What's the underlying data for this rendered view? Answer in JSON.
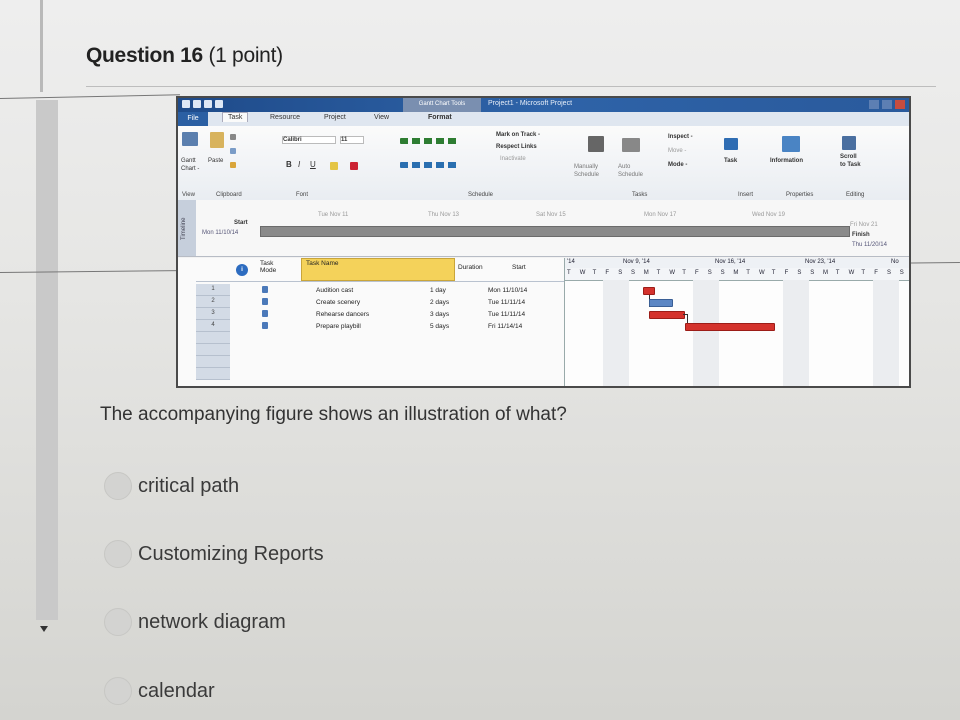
{
  "question": {
    "number_label": "Question 16",
    "points_label": "(1 point)",
    "prompt": "The accompanying figure shows an illustration of what?",
    "options": [
      {
        "label": "critical path"
      },
      {
        "label": "Customizing Reports"
      },
      {
        "label": "network diagram"
      },
      {
        "label": "calendar"
      }
    ]
  },
  "project_window": {
    "context_tab": "Gantt Chart Tools",
    "title": "Project1 - Microsoft Project",
    "tabs": [
      "File",
      "Task",
      "Resource",
      "Project",
      "View",
      "Format"
    ],
    "ribbon": {
      "view_group": [
        "Gantt",
        "Chart -",
        "View"
      ],
      "clipboard": {
        "paste": "Paste",
        "label": "Clipboard"
      },
      "font": {
        "name": "Calibri",
        "size": "11",
        "label": "Font"
      },
      "schedule": {
        "mark": "Mark on Track -",
        "respect": "Respect Links",
        "inactivate": "Inactivate",
        "label": "Schedule"
      },
      "tasks": {
        "manually": "Manually",
        "schedule_word": "Schedule",
        "auto": "Auto",
        "schedule_word2": "Schedule",
        "inspect": "Inspect -",
        "move": "Move -",
        "mode": "Mode -",
        "label": "Tasks"
      },
      "insert": {
        "task": "Task",
        "label": "Insert"
      },
      "properties": {
        "information": "Information",
        "label": "Properties"
      },
      "editing": {
        "scroll": "Scroll",
        "to_task": "to Task",
        "label": "Editing"
      }
    },
    "timeline": {
      "side_label": "Timeline",
      "dates": [
        "Tue Nov 11",
        "Thu Nov 13",
        "Sat Nov 15",
        "Mon Nov 17",
        "Wed Nov 19",
        "Fri Nov 21"
      ],
      "start_label": "Start",
      "start_date": "Mon 11/10/14",
      "finish_label": "Finish",
      "finish_date": "Thu 11/20/14"
    },
    "table": {
      "headers": {
        "info": "i",
        "mode": "Task Mode",
        "name": "Task Name",
        "duration": "Duration",
        "start": "Start"
      },
      "rows": [
        {
          "id": "1",
          "name": "Audition cast",
          "duration": "1 day",
          "start": "Mon 11/10/14"
        },
        {
          "id": "2",
          "name": "Create scenery",
          "duration": "2 days",
          "start": "Tue 11/11/14"
        },
        {
          "id": "3",
          "name": "Rehearse dancers",
          "duration": "3 days",
          "start": "Tue 11/11/14"
        },
        {
          "id": "4",
          "name": "Prepare playbill",
          "duration": "5 days",
          "start": "Fri 11/14/14"
        }
      ]
    },
    "gantt": {
      "week_labels": [
        "'14",
        "Nov 9, '14",
        "Nov 16, '14",
        "Nov 23, '14",
        "No"
      ],
      "day_letters": [
        "T",
        "W",
        "T",
        "F",
        "S",
        "S",
        "M",
        "T",
        "W",
        "T",
        "F",
        "S",
        "S",
        "M",
        "T",
        "W",
        "T",
        "F",
        "S",
        "S",
        "M",
        "T",
        "W",
        "T",
        "F",
        "S",
        "S"
      ],
      "bar_color_critical": "#d4322c",
      "bar_color_normal": "#5b86c4"
    }
  }
}
